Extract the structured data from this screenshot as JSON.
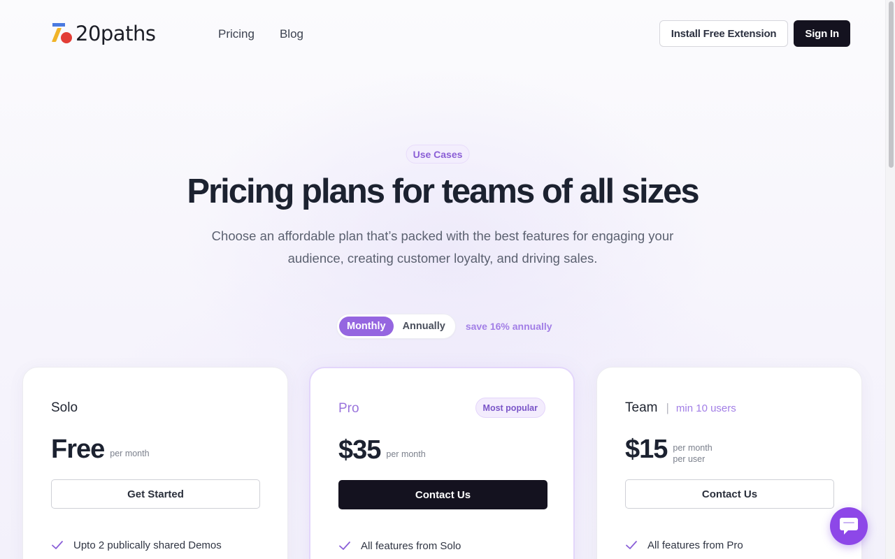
{
  "brand": {
    "name": "20paths"
  },
  "nav": {
    "items": [
      "Pricing",
      "Blog"
    ]
  },
  "header": {
    "install_label": "Install Free Extension",
    "signin_label": "Sign In"
  },
  "hero": {
    "badge": "Use Cases",
    "title": "Pricing plans for teams of all sizes",
    "subtitle": "Choose an affordable plan that’s packed with the best features for engaging your audience, creating customer loyalty, and driving sales."
  },
  "billing_toggle": {
    "options": [
      "Monthly",
      "Annually"
    ],
    "selected": "Monthly",
    "save_note": "save 16% annually"
  },
  "plans": [
    {
      "name": "Solo",
      "price": "Free",
      "unit_lines": [
        "per month"
      ],
      "cta": "Get Started",
      "features": [
        "Upto 2 publically shared Demos"
      ]
    },
    {
      "name": "Pro",
      "badge": "Most popular",
      "price": "$35",
      "unit_lines": [
        "per month"
      ],
      "cta": "Contact Us",
      "features": [
        "All features from Solo"
      ]
    },
    {
      "name": "Team",
      "note": "min 10 users",
      "price": "$15",
      "unit_lines": [
        "per month",
        "per user"
      ],
      "cta": "Contact Us",
      "features": [
        "All features from Pro"
      ]
    }
  ],
  "colors": {
    "accent": "#9566e0",
    "dark": "#14121f",
    "chat": "#8d47e8"
  },
  "icons": {
    "check": "check-icon",
    "chat": "chat-icon"
  }
}
